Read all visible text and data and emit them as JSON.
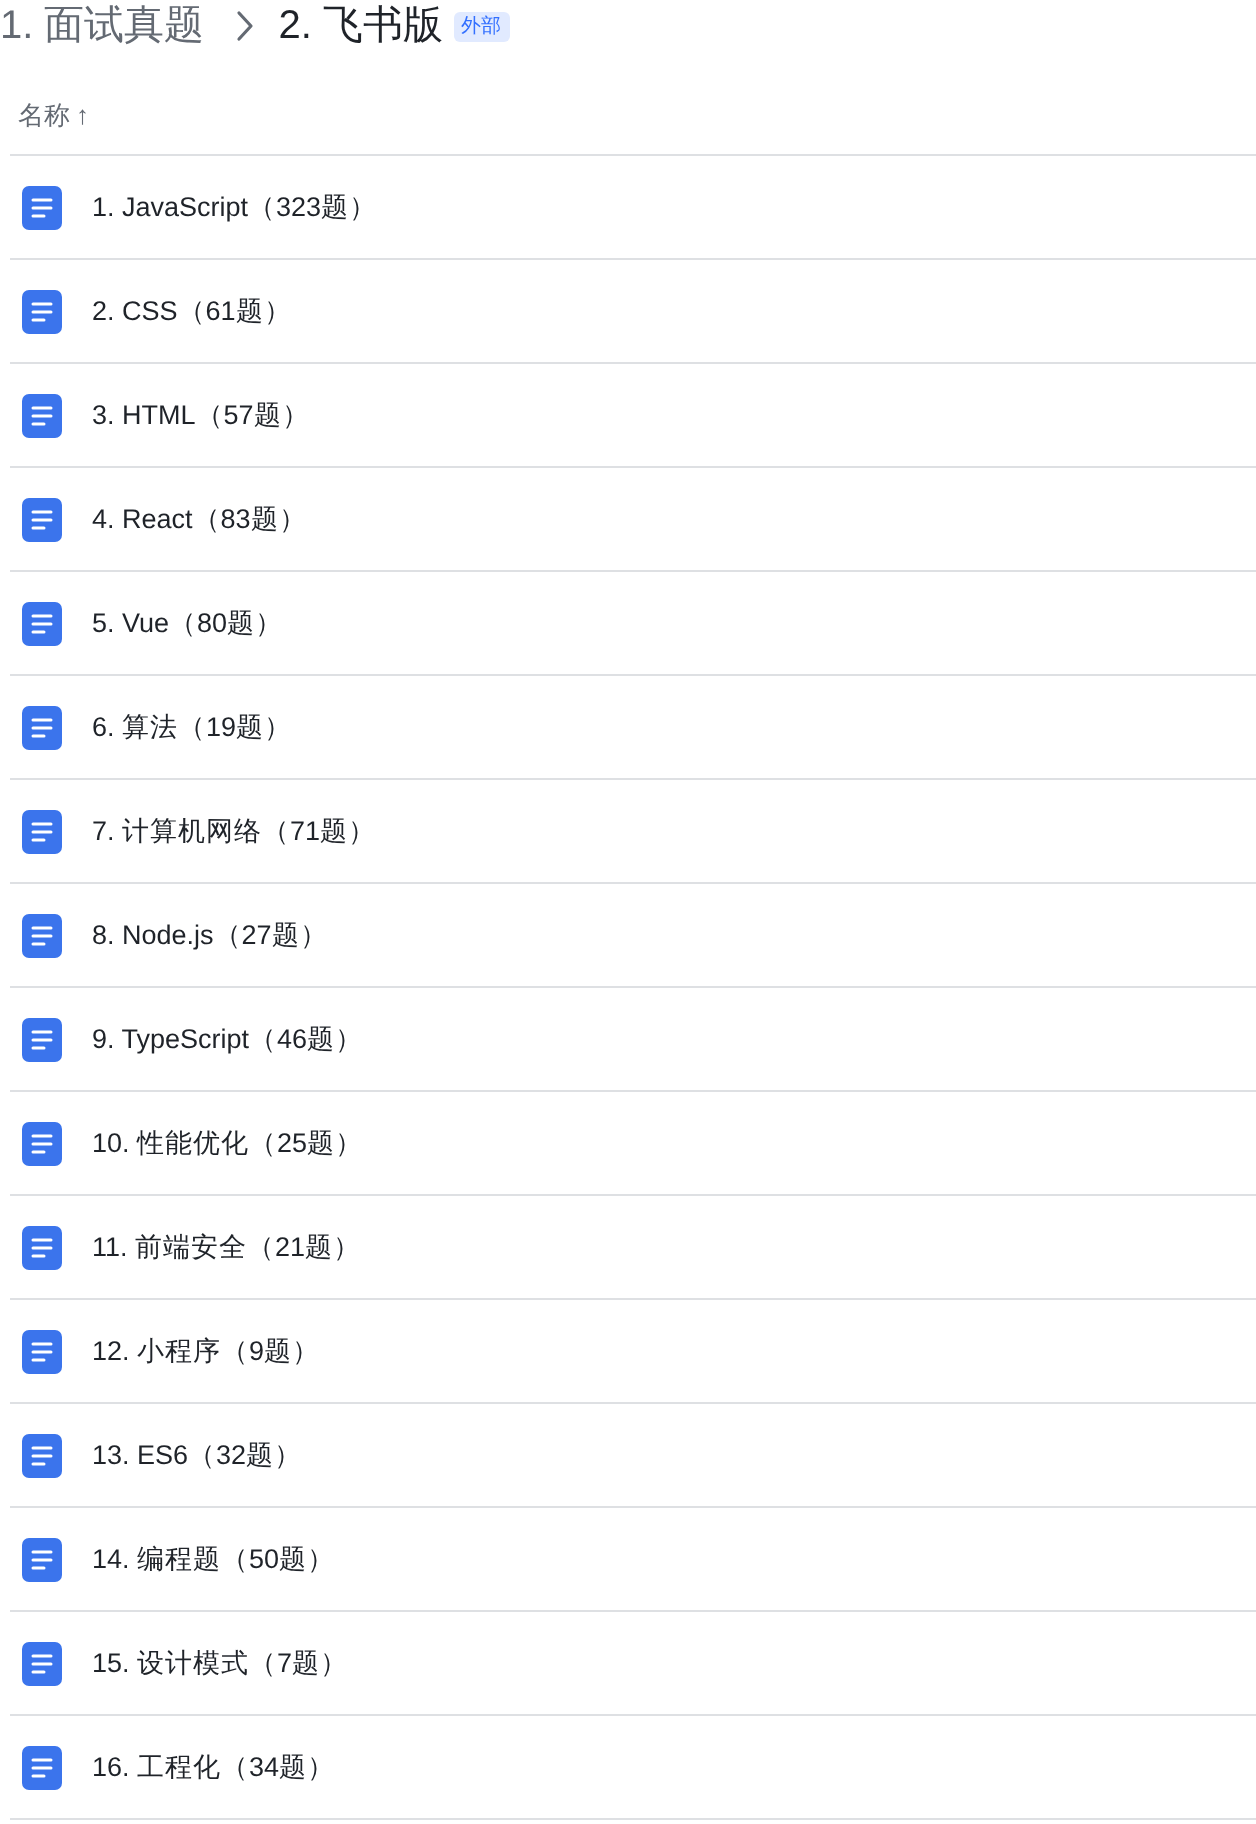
{
  "breadcrumb": [
    {
      "label": "1. 面试真题",
      "current": false
    },
    {
      "label": "2. 飞书版",
      "current": true,
      "badge": "外部"
    }
  ],
  "table": {
    "columns": [
      {
        "label": "名称",
        "sort_indicator": "↑"
      }
    ],
    "rows": [
      {
        "name": "1. JavaScript（323题）"
      },
      {
        "name": "2. CSS（61题）"
      },
      {
        "name": "3. HTML（57题）"
      },
      {
        "name": "4. React（83题）"
      },
      {
        "name": "5. Vue（80题）"
      },
      {
        "name": "6. 算法（19题）"
      },
      {
        "name": "7. 计算机网络（71题）"
      },
      {
        "name": "8. Node.js（27题）"
      },
      {
        "name": "9. TypeScript（46题）"
      },
      {
        "name": "10. 性能优化（25题）"
      },
      {
        "name": "11. 前端安全（21题）"
      },
      {
        "name": "12. 小程序（9题）"
      },
      {
        "name": "13. ES6（32题）"
      },
      {
        "name": "14. 编程题（50题）"
      },
      {
        "name": "15. 设计模式（7题）"
      },
      {
        "name": "16. 工程化（34题）"
      }
    ]
  }
}
